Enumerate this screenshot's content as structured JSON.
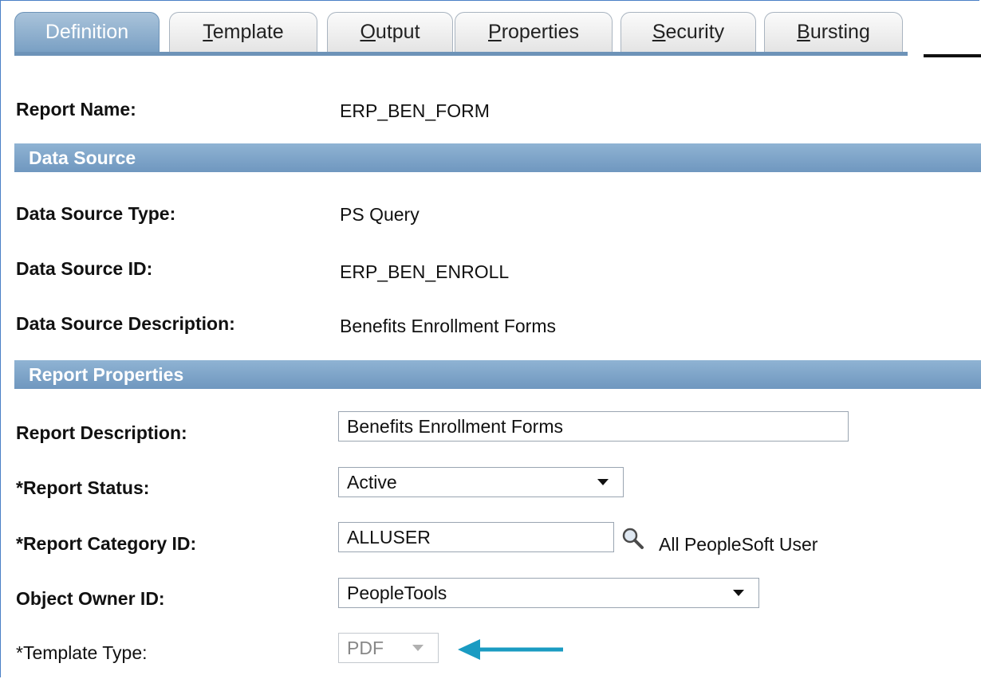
{
  "tabs": [
    {
      "label": "Definition",
      "active": true
    },
    {
      "label": "Template",
      "active": false
    },
    {
      "label": "Output",
      "active": false
    },
    {
      "label": "Properties",
      "active": false
    },
    {
      "label": "Security",
      "active": false
    },
    {
      "label": "Bursting",
      "active": false
    }
  ],
  "report": {
    "name_label": "Report Name:",
    "name_value": "ERP_BEN_FORM"
  },
  "data_source": {
    "header": "Data Source",
    "type_label": "Data Source Type:",
    "type_value": "PS Query",
    "id_label": "Data Source ID:",
    "id_value": "ERP_BEN_ENROLL",
    "desc_label": "Data Source Description:",
    "desc_value": "Benefits Enrollment Forms"
  },
  "report_properties": {
    "header": "Report Properties",
    "description_label": "Report Description:",
    "description_value": "Benefits Enrollment Forms",
    "status_label": "*Report Status:",
    "status_value": "Active",
    "category_label": "*Report Category ID:",
    "category_value": "ALLUSER",
    "category_desc": "All PeopleSoft User",
    "owner_label": "Object Owner ID:",
    "owner_value": "PeopleTools",
    "template_type_label": "*Template Type:",
    "template_type_value": "PDF"
  },
  "colors": {
    "tab_active": "#7aa0c4",
    "section_header": "#6f97bf",
    "annotation_arrow": "#1a9bc2"
  }
}
